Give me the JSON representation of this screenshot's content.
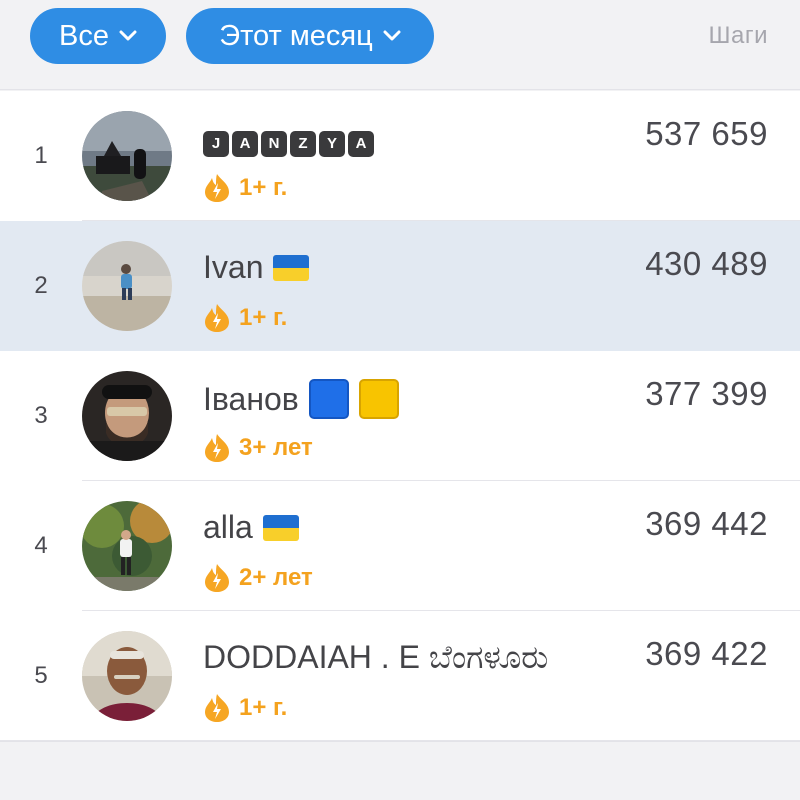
{
  "filters": {
    "group_label": "Все",
    "period_label": "Этот месяц",
    "sort_label": "Шаги"
  },
  "rows": [
    {
      "rank": "1",
      "name": "JANZYA",
      "name_letters": [
        "J",
        "A",
        "N",
        "Z",
        "Y",
        "A"
      ],
      "streak": "1+ г.",
      "steps": "537 659"
    },
    {
      "rank": "2",
      "name": "Ivan",
      "streak": "1+ г.",
      "steps": "430 489"
    },
    {
      "rank": "3",
      "name": "Іванов",
      "streak": "3+ лет",
      "steps": "377 399"
    },
    {
      "rank": "4",
      "name": "alla",
      "streak": "2+ лет",
      "steps": "369 442"
    },
    {
      "rank": "5",
      "name": "DODDAIAH . E ಬೆಂಗಳೂರು",
      "streak": "1+ г.",
      "steps": "369 422"
    }
  ],
  "colors": {
    "accent": "#2f8de4",
    "streak": "#f4a21e",
    "highlight_row": "#e2e9f2"
  },
  "icons": {
    "dropdown": "chevron-down-icon",
    "streak": "fire-icon"
  }
}
